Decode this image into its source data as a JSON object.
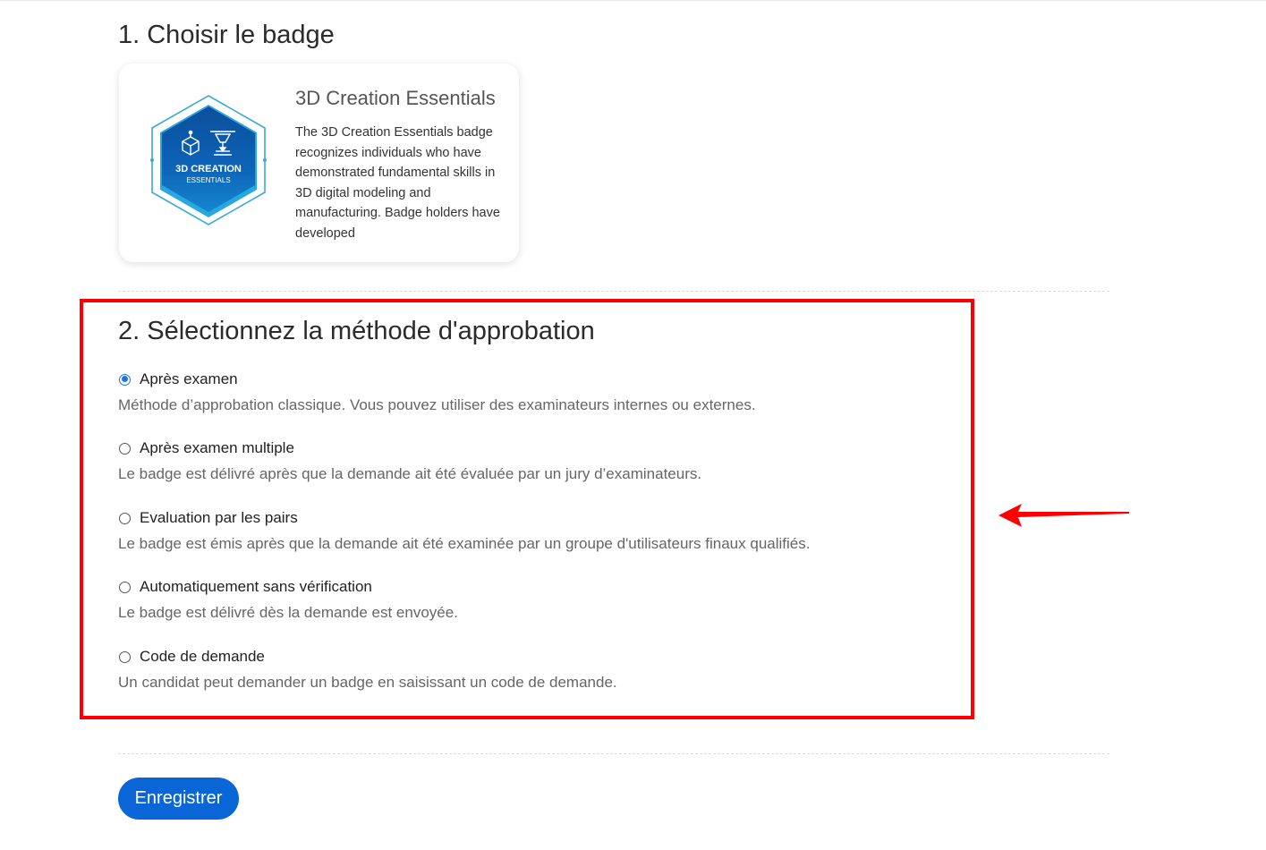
{
  "section1": {
    "title": "1. Choisir le badge"
  },
  "badge": {
    "name": "3D Creation Essentials",
    "description": "The 3D Creation Essentials badge recognizes individuals who have demonstrated fundamental skills in 3D digital modeling and manufacturing. Badge holders have developed",
    "logo_title": "3D CREATION",
    "logo_subtitle": "ESSENTIALS",
    "logo_icons": [
      "cube-icon",
      "3d-printer-icon"
    ],
    "colors": {
      "hex_dark": "#0b4f9c",
      "hex_light": "#1d9ad6",
      "outline": "#3ba9d6"
    }
  },
  "section2": {
    "title": "2. Sélectionnez la méthode d'approbation",
    "options": [
      {
        "label": "Après examen",
        "description": "Méthode d’approbation classique. Vous pouvez utiliser des examinateurs internes ou externes.",
        "checked": true
      },
      {
        "label": "Après examen multiple",
        "description": "Le badge est délivré après que la demande ait été évaluée par un jury d’examinateurs.",
        "checked": false
      },
      {
        "label": "Evaluation par les pairs",
        "description": "Le badge est émis après que la demande ait été examinée par un groupe d'utilisateurs finaux qualifiés.",
        "checked": false
      },
      {
        "label": "Automatiquement sans vérification",
        "description": "Le badge est délivré dès la demande est envoyée.",
        "checked": false
      },
      {
        "label": "Code de demande",
        "description": "Un candidat peut demander un badge en saisissant un code de demande.",
        "checked": false
      }
    ]
  },
  "annotation": {
    "highlight_color": "#ff0000"
  },
  "actions": {
    "save_label": "Enregistrer",
    "accent_color": "#0a66d6"
  }
}
